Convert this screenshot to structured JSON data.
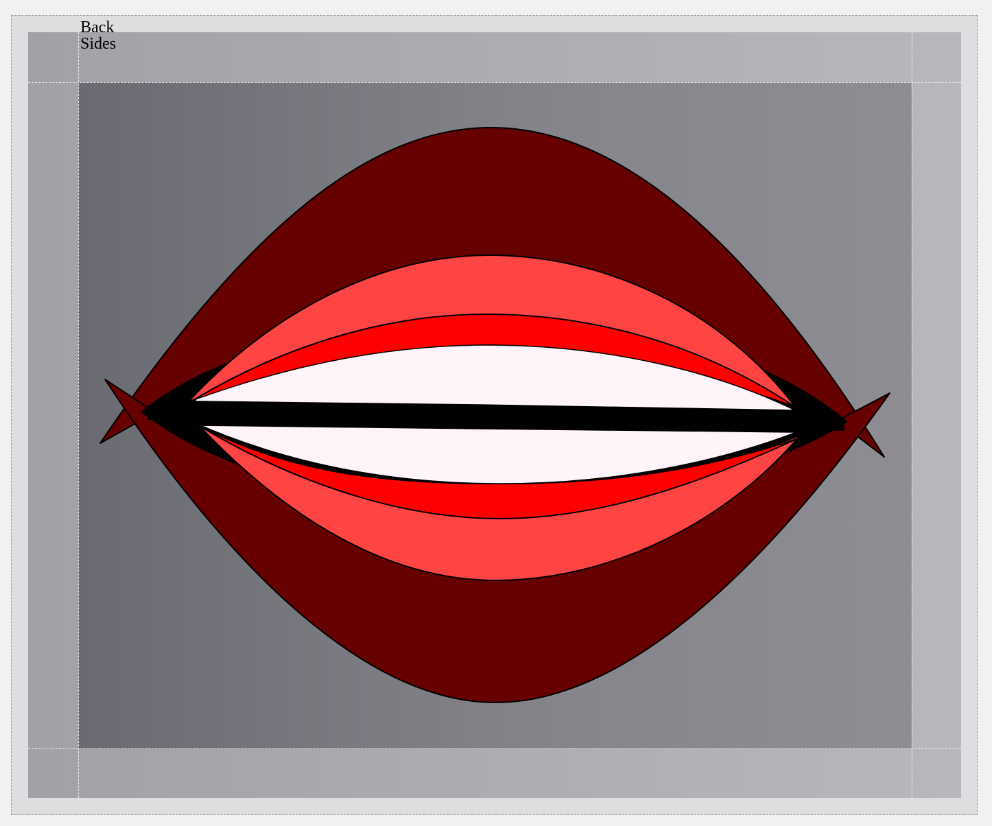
{
  "labels": {
    "back": "Back",
    "sides": "Sides"
  },
  "colors": {
    "page_background": "#f1f1f2",
    "outer_frame": "#dedee0",
    "sides_band": "#adadb1",
    "back_panel": "#7b7b82",
    "outer_lip": "#660000",
    "inner_lip": "#ff4444",
    "lip_edge": "#ff0000",
    "teeth": "#fff4f9",
    "mouth_line": "#000000"
  },
  "shapes": [
    "outer-lips",
    "inner-lips",
    "lip-edges",
    "teeth",
    "mouth-line"
  ]
}
